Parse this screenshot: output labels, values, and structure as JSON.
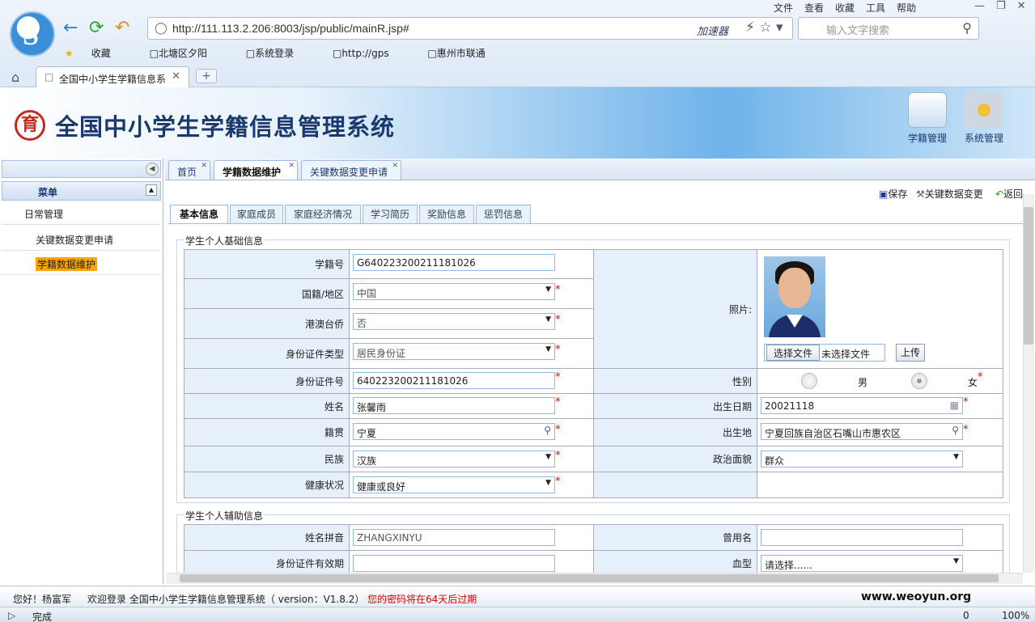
{
  "browser": {
    "url": "http://111.113.2.206:8003/jsp/public/mainR.jsp#",
    "accelerator": "加速器",
    "search_placeholder": "输入文字搜索",
    "menu": [
      "文件",
      "查看",
      "收藏",
      "工具",
      "帮助"
    ],
    "bookmarks": [
      "收藏",
      "北塘区夕阳",
      "系统登录",
      "http://gps",
      "惠州市联通"
    ],
    "tab_title": "全国中小学生学籍信息系",
    "status_text": "完成",
    "zoom": "100%",
    "status_count": "0"
  },
  "app": {
    "title": "全国中小学生学籍信息管理系统",
    "emblem": "育",
    "top_buttons": [
      "学籍管理",
      "系统管理"
    ]
  },
  "left_menu": {
    "header": "菜单",
    "group": "日常管理",
    "items": [
      "关键数据变更申请",
      "学籍数据维护"
    ]
  },
  "content_tabs": [
    "首页",
    "学籍数据维护",
    "关键数据变更申请"
  ],
  "toolbar": {
    "save": "保存",
    "key_change": "关键数据变更",
    "back": "返回"
  },
  "form_tabs": [
    "基本信息",
    "家庭成员",
    "家庭经济情况",
    "学习简历",
    "奖励信息",
    "惩罚信息"
  ],
  "basic": {
    "legend": "学生个人基础信息",
    "student_no_label": "学籍号",
    "student_no": "G640223200211181026",
    "nationality_label": "国籍/地区",
    "nationality": "中国",
    "overseas_label": "港澳台侨",
    "overseas": "否",
    "id_type_label": "身份证件类型",
    "id_type": "居民身份证",
    "id_no_label": "身份证件号",
    "id_no": "640223200211181026",
    "name_label": "姓名",
    "name": "张馨雨",
    "native_label": "籍贯",
    "native": "宁夏",
    "ethnic_label": "民族",
    "ethnic": "汉族",
    "health_label": "健康状况",
    "health": "健康或良好",
    "photo_label": "照片:",
    "choose_file": "选择文件",
    "no_file": "未选择文件",
    "upload": "上传",
    "gender_label": "性别",
    "male": "男",
    "female": "女",
    "birth_label": "出生日期",
    "birth": "20021118",
    "birthplace_label": "出生地",
    "birthplace": "宁夏回族自治区石嘴山市惠农区",
    "political_label": "政治面貌",
    "political": "群众"
  },
  "aux": {
    "legend": "学生个人辅助信息",
    "pinyin_label": "姓名拼音",
    "pinyin": "ZHANGXINYU",
    "former_label": "曾用名",
    "former": "",
    "id_valid_label": "身份证件有效期",
    "id_valid": "",
    "blood_label": "血型",
    "blood": "请选择......"
  },
  "footer": {
    "greeting": "您好！杨富军",
    "welcome": "欢迎登录 全国中小学生学籍信息管理系统（ version：V1.8.2）",
    "warning": "您的密码将在64天后过期",
    "right": "www.weoyun.org"
  }
}
